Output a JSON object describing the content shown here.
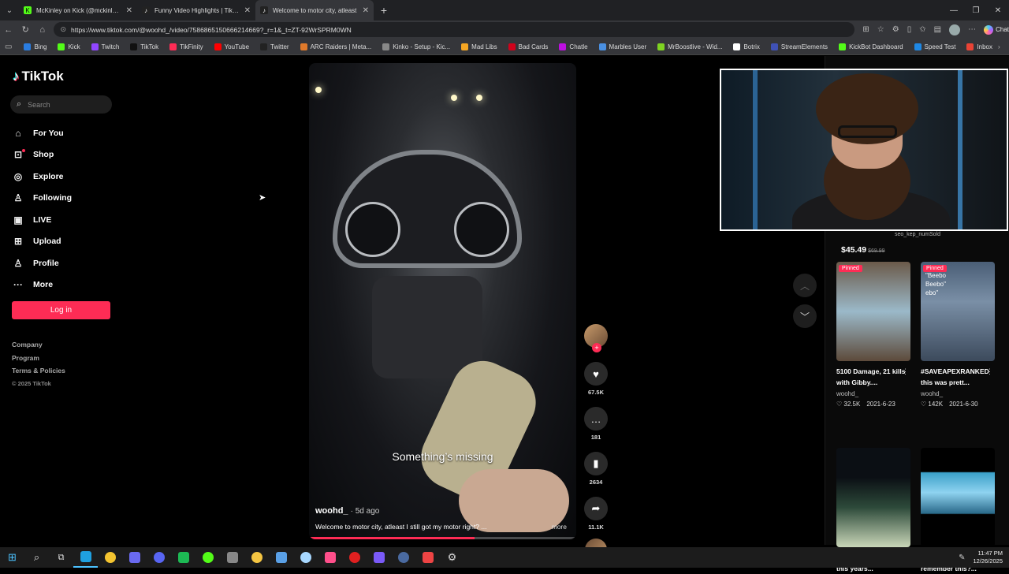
{
  "browser": {
    "tabs": [
      {
        "title": "McKinley on Kick (@mckinley.tv) |",
        "icon": "kick-icon",
        "active": false
      },
      {
        "title": "Funny Video Highlights | TikTok",
        "icon": "tiktok-icon",
        "active": false
      },
      {
        "title": "Welcome to motor city, atleast",
        "icon": "tiktok-icon",
        "active": true
      }
    ],
    "url": "https://www.tiktok.com/@woohd_/video/7586865150666214669?_r=1&_t=ZT-92WrSPRM0WN",
    "chat_label": "Chat",
    "bookmarks": [
      {
        "label": "Bing",
        "color": "#2a7de1"
      },
      {
        "label": "Kick",
        "color": "#53fc18"
      },
      {
        "label": "Twitch",
        "color": "#9146ff"
      },
      {
        "label": "TikTok",
        "color": "#111111"
      },
      {
        "label": "TikFinity",
        "color": "#fe2c55"
      },
      {
        "label": "YouTube",
        "color": "#ff0000"
      },
      {
        "label": "Twitter",
        "color": "#222222"
      },
      {
        "label": "ARC Raiders | Meta...",
        "color": "#e07a2b"
      },
      {
        "label": "Kinko - Setup - Kic...",
        "color": "#888888"
      },
      {
        "label": "Mad Libs",
        "color": "#f5a623"
      },
      {
        "label": "Bad Cards",
        "color": "#d0021b"
      },
      {
        "label": "Chatle",
        "color": "#bd10e0"
      },
      {
        "label": "Marbles User",
        "color": "#4a90e2"
      },
      {
        "label": "MrBoostlive - Wid...",
        "color": "#7ed321"
      },
      {
        "label": "Botrix",
        "color": "#ffffff"
      },
      {
        "label": "StreamElements",
        "color": "#3f51b5"
      },
      {
        "label": "KickBot Dashboard",
        "color": "#53fc18"
      },
      {
        "label": "Speed Test",
        "color": "#1e88e5"
      },
      {
        "label": "Inbox",
        "color": "#ea4335"
      }
    ]
  },
  "sidebar": {
    "logo": "TikTok",
    "search_placeholder": "Search",
    "nav": [
      {
        "label": "For You",
        "icon": "home-icon",
        "glyph": "⌂"
      },
      {
        "label": "Shop",
        "icon": "shop-icon",
        "glyph": "⊡",
        "dot": true
      },
      {
        "label": "Explore",
        "icon": "compass-icon",
        "glyph": "◎"
      },
      {
        "label": "Following",
        "icon": "following-icon",
        "glyph": "♙"
      },
      {
        "label": "LIVE",
        "icon": "live-icon",
        "glyph": "▣"
      },
      {
        "label": "Upload",
        "icon": "upload-icon",
        "glyph": "⊞"
      },
      {
        "label": "Profile",
        "icon": "profile-icon",
        "glyph": "♙"
      },
      {
        "label": "More",
        "icon": "more-icon",
        "glyph": "···"
      }
    ],
    "login": "Log in",
    "footer": [
      "Company",
      "Program",
      "Terms & Policies"
    ],
    "copyright": "© 2025 TikTok"
  },
  "video": {
    "overlay_caption": "Something’s missing",
    "author": "woohd_",
    "age": "· 5d ago",
    "description": "Welcome to motor city, atleast I still got my motor right? ...",
    "more": "more",
    "progress": 0.62,
    "accent": "#fe2c55"
  },
  "actions": {
    "likes": "67.5K",
    "comments": "181",
    "saves": "2634",
    "shares": "11.1K"
  },
  "right_panel": {
    "product_name": "seo_kep_numSold",
    "price": "$45.49",
    "old_price": "$69.99",
    "cards": [
      {
        "title": "5100 Damage, 21 kills with Gibby....",
        "author": "woohd_",
        "likes": "32.5K",
        "date": "2021-6-23",
        "pinned": "Pinned",
        "thumb": "linear-gradient(180deg,#6b5a4a,#9bb9c9 50%,#5d4a3a)"
      },
      {
        "title": "#SAVEAPEXRANKED this was prett...",
        "author": "woohd_",
        "likes": "142K",
        "date": "2021-6-30",
        "pinned": "Pinned",
        "thumb": "linear-gradient(180deg,#4a5e76,#7a8fa6 40%,#3c4a5c)",
        "overlay": "\"Beebo\nBeebo\"\nebo\""
      },
      {
        "title": "Wish i was going to this years...",
        "author": "",
        "likes": "",
        "date": "",
        "pinned": "",
        "thumb": "linear-gradient(180deg,#0b0f14 30%,#2d4a3a 60%,#c9d6b8)"
      },
      {
        "title": "@Akademiks you remember this?...",
        "author": "",
        "likes": "",
        "date": "",
        "pinned": "",
        "thumb": "linear-gradient(180deg,#000 0%,#000 24%,#3aa0c8 25%,#8fd3f0 45%,#2a6a8a 66%,#000 67%)"
      }
    ]
  },
  "taskbar": {
    "time": "11:47 PM",
    "date": "12/26/2025",
    "icons": [
      {
        "name": "start-icon",
        "color": "#4cc2ff"
      },
      {
        "name": "search-icon",
        "color": "#dddddd"
      },
      {
        "name": "task-view-icon",
        "color": "#dddddd"
      },
      {
        "name": "edge-icon",
        "color": "#1fa0e0"
      },
      {
        "name": "chrome-icon",
        "color": "#f4c430"
      },
      {
        "name": "app-icon",
        "color": "#6a6af0"
      },
      {
        "name": "discord-icon",
        "color": "#5865f2"
      },
      {
        "name": "spotify-icon",
        "color": "#1db954"
      },
      {
        "name": "app-green-icon",
        "color": "#53fc18"
      },
      {
        "name": "app-grey-icon",
        "color": "#888888"
      },
      {
        "name": "folder-icon",
        "color": "#f5c542"
      },
      {
        "name": "app-blue-icon",
        "color": "#5aa0e6"
      },
      {
        "name": "app-light-icon",
        "color": "#a8d8ff"
      },
      {
        "name": "app-pink-icon",
        "color": "#ff4f8b"
      },
      {
        "name": "app-red-icon",
        "color": "#e02020"
      },
      {
        "name": "app-purple-icon",
        "color": "#7a5af8"
      },
      {
        "name": "app-dark-icon",
        "color": "#4a6aa0"
      },
      {
        "name": "app-outline-icon",
        "color": "#e44"
      },
      {
        "name": "settings-icon",
        "color": "#dddddd"
      }
    ]
  }
}
